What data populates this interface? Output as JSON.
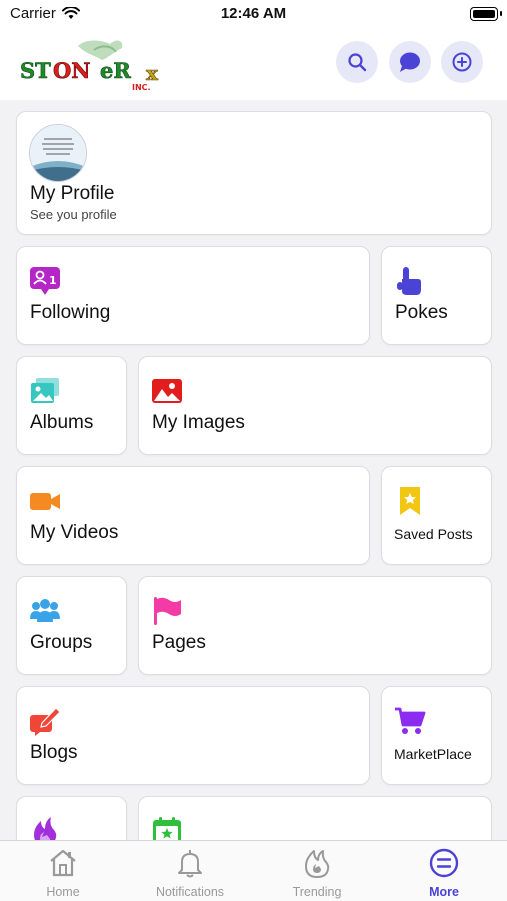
{
  "status_bar": {
    "carrier": "Carrier",
    "time": "12:46 AM"
  },
  "header": {
    "logo_text": "STONeRx",
    "logo_subtext": "INC.",
    "actions": [
      "search-icon",
      "chat-icon",
      "add-circle-icon"
    ],
    "accent_color": "#4b42d6",
    "button_bg": "#e7e8f7"
  },
  "profile": {
    "title": "My Profile",
    "subtitle": "See you profile",
    "avatar_text": "Wisdom bring use the world in you. Be strong and choose to be positive."
  },
  "menu": {
    "following": "Following",
    "pokes": "Pokes",
    "albums": "Albums",
    "my_images": "My Images",
    "my_videos": "My Videos",
    "saved_posts": "Saved Posts",
    "groups": "Groups",
    "pages": "Pages",
    "blogs": "Blogs",
    "marketplace": "MarketPlace"
  },
  "icon_colors": {
    "following": "#b526c6",
    "pokes": "#4b42d6",
    "albums": "#38c7c0",
    "my_images": "#e11d1d",
    "my_videos": "#f58a23",
    "saved_posts": "#f2c713",
    "groups": "#3aa3e8",
    "pages": "#f23ba5",
    "blogs": "#f04637",
    "marketplace": "#8b2cf0",
    "fire": "#a22fdc",
    "events": "#2fbf3d"
  },
  "tabs": [
    {
      "label": "Home",
      "icon": "home-icon",
      "active": false
    },
    {
      "label": "Notifications",
      "icon": "bell-icon",
      "active": false
    },
    {
      "label": "Trending",
      "icon": "fire-icon",
      "active": false
    },
    {
      "label": "More",
      "icon": "menu-circle-icon",
      "active": true
    }
  ]
}
